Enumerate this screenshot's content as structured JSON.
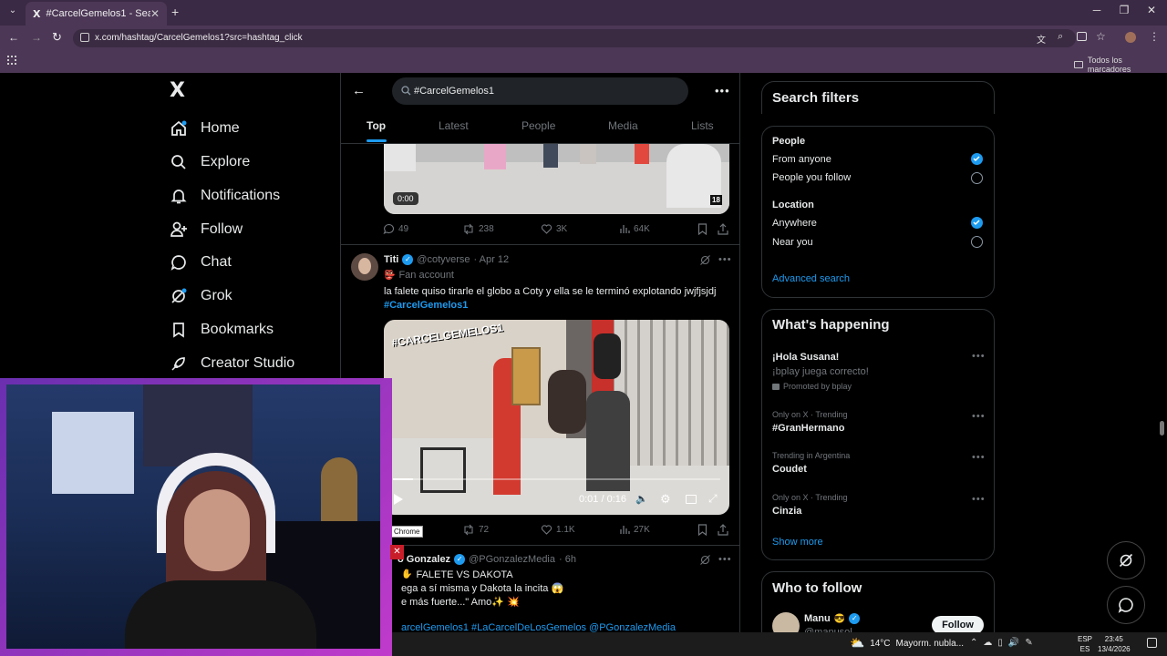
{
  "browser": {
    "tab_title": "#CarcelGemelos1 - Search / X",
    "tab_logo": "X",
    "url": "x.com/hashtag/CarcelGemelos1?src=hashtag_click",
    "bookmarks_label": "Todos los marcadores"
  },
  "nav": {
    "logo": "X",
    "items": [
      "Home",
      "Explore",
      "Notifications",
      "Follow",
      "Chat",
      "Grok",
      "Bookmarks",
      "Creator Studio"
    ]
  },
  "search": {
    "query": "#CarcelGemelos1",
    "tabs": [
      "Top",
      "Latest",
      "People",
      "Media",
      "Lists"
    ]
  },
  "post1": {
    "video_time": "0:00",
    "age_badge": "18",
    "replies": "49",
    "reposts": "238",
    "likes": "3K",
    "views": "64K"
  },
  "post2": {
    "name": "Titi",
    "handle": "@cotyverse",
    "date": "· Apr 12",
    "label": "Fan account",
    "text": "la falete quiso tirarle el globo a Coty y ella se le terminó explotando jwjfjsjdj",
    "hashtag": "#CarcelGemelos1",
    "video_overlay": "#CARCELGEMELOS1",
    "video_time": "0:01 / 0:16",
    "video_progress": 0.06,
    "tooltip": "Chrome",
    "reposts": "72",
    "likes": "1.1K",
    "views": "27K"
  },
  "post3": {
    "name": "o Gonzalez",
    "handle": "@PGonzalezMedia",
    "date": "· 6h",
    "line1": "FALETE VS DAKOTA",
    "line2": "ega a sí misma y Dakota la incita 😱",
    "line3": "e más fuerte...\" Amo✨ 💥",
    "tags": "arcelGemelos1 #LaCarcelDeLosGemelos @PGonzalezMedia"
  },
  "filters": {
    "title": "Search filters",
    "people_label": "People",
    "from_anyone": "From anyone",
    "people_you_follow": "People you follow",
    "location_label": "Location",
    "anywhere": "Anywhere",
    "near_you": "Near you",
    "advanced": "Advanced search"
  },
  "happening": {
    "title": "What's happening",
    "promo_title": "¡Hola Susana!",
    "promo_text": "¡bplay juega correcto!",
    "promo_by": "Promoted by bplay",
    "trends": [
      {
        "meta": "Only on X · Trending",
        "name": "#GranHermano"
      },
      {
        "meta": "Trending in Argentina",
        "name": "Coudet"
      },
      {
        "meta": "Only on X · Trending",
        "name": "Cinzia"
      }
    ],
    "show_more": "Show more"
  },
  "who_to_follow": {
    "title": "Who to follow",
    "user_name": "Manu",
    "user_emoji": "😎",
    "user_handle": "@manusol",
    "follow_label": "Follow"
  },
  "taskbar": {
    "weather": "14°C",
    "weather_text": "Mayorm. nubla...",
    "lang1": "ESP",
    "lang2": "ES",
    "time": "23:45",
    "date": "13/4/2026"
  },
  "colors": {
    "accent": "#1d9bf0",
    "chrome": "#4c3756",
    "webcam_border": "#7a2fb0"
  }
}
